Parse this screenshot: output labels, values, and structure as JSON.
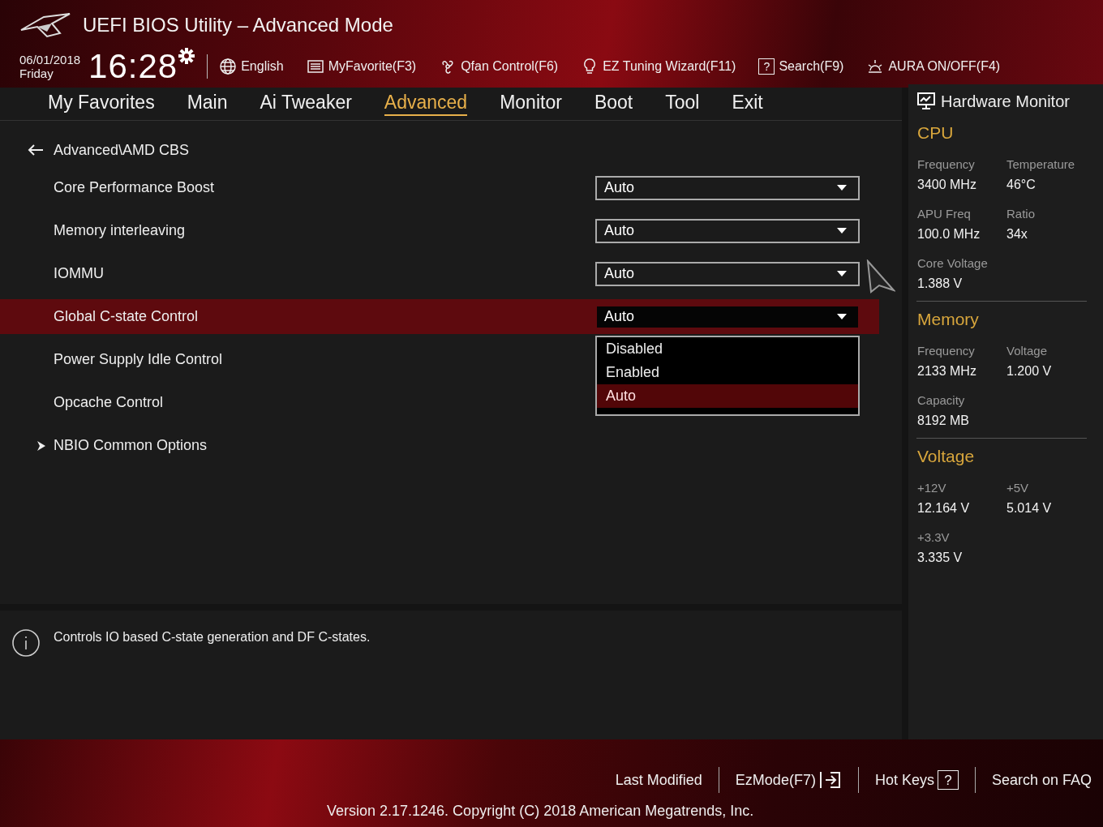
{
  "window": {
    "title": "UEFI BIOS Utility – Advanced Mode"
  },
  "clock": {
    "date": "06/01/2018",
    "day": "Friday",
    "time": "16:28"
  },
  "toolbar": [
    {
      "kind": "globe",
      "label": "English"
    },
    {
      "kind": "list",
      "label": "MyFavorite(F3)"
    },
    {
      "kind": "fan",
      "label": "Qfan Control(F6)"
    },
    {
      "kind": "bulb",
      "label": "EZ Tuning Wizard(F11)"
    },
    {
      "kind": "help",
      "glyph": "?",
      "label": "Search(F9)"
    },
    {
      "kind": "aura",
      "label": "AURA ON/OFF(F4)"
    }
  ],
  "tabs": [
    {
      "label": "My Favorites",
      "selected": false
    },
    {
      "label": "Main",
      "selected": false
    },
    {
      "label": "Ai Tweaker",
      "selected": false
    },
    {
      "label": "Advanced",
      "selected": true
    },
    {
      "label": "Monitor",
      "selected": false
    },
    {
      "label": "Boot",
      "selected": false
    },
    {
      "label": "Tool",
      "selected": false
    },
    {
      "label": "Exit",
      "selected": false
    }
  ],
  "breadcrumb": "Advanced\\AMD CBS",
  "settings": [
    {
      "kind": "select",
      "label": "Core Performance Boost",
      "value": "Auto",
      "selected": false
    },
    {
      "kind": "select",
      "label": "Memory interleaving",
      "value": "Auto",
      "selected": false
    },
    {
      "kind": "select",
      "label": "IOMMU",
      "value": "Auto",
      "selected": false
    },
    {
      "kind": "select",
      "label": "Global C-state Control",
      "value": "Auto",
      "selected": true,
      "expanded": true
    },
    {
      "kind": "plain",
      "label": "Power Supply Idle Control",
      "selected": false
    },
    {
      "kind": "plain",
      "label": "Opcache Control",
      "selected": false
    },
    {
      "kind": "submenu",
      "label": "NBIO Common Options",
      "selected": false
    }
  ],
  "dropdown": {
    "options": [
      {
        "label": "Disabled",
        "selected": false
      },
      {
        "label": "Enabled",
        "selected": false
      },
      {
        "label": "Auto",
        "selected": true
      }
    ]
  },
  "help_text": "Controls IO based C-state generation and DF C-states.",
  "hardware_monitor": {
    "title": "Hardware Monitor",
    "sections": [
      {
        "title": "CPU",
        "items": [
          {
            "label": "Frequency",
            "value": "3400 MHz"
          },
          {
            "label": "Temperature",
            "value": "46°C"
          },
          {
            "label": "APU Freq",
            "value": "100.0 MHz"
          },
          {
            "label": "Ratio",
            "value": "34x"
          },
          {
            "label": "Core Voltage",
            "value": "1.388 V"
          }
        ]
      },
      {
        "title": "Memory",
        "items": [
          {
            "label": "Frequency",
            "value": "2133 MHz"
          },
          {
            "label": "Voltage",
            "value": "1.200 V"
          },
          {
            "label": "Capacity",
            "value": "8192 MB"
          }
        ]
      },
      {
        "title": "Voltage",
        "items": [
          {
            "label": "+12V",
            "value": "12.164 V"
          },
          {
            "label": "+5V",
            "value": "5.014 V"
          },
          {
            "label": "+3.3V",
            "value": "3.335 V"
          }
        ]
      }
    ]
  },
  "footer": {
    "links": [
      {
        "kind": "text",
        "label": "Last Modified"
      },
      {
        "kind": "ezmode",
        "label": "EzMode(F7)"
      },
      {
        "kind": "hotkeys",
        "label": "Hot Keys",
        "glyph": "?"
      },
      {
        "kind": "text",
        "label": "Search on FAQ"
      }
    ],
    "version": "Version 2.17.1246. Copyright (C) 2018 American Megatrends, Inc."
  }
}
